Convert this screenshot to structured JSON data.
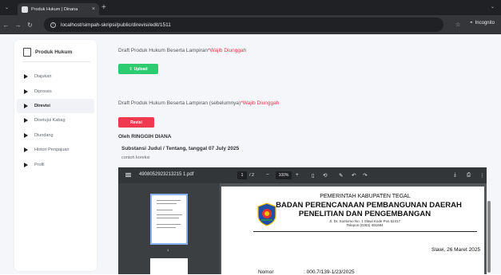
{
  "browser": {
    "tab_title": "Produk Hukum | Dinana",
    "tab_close": "×",
    "new_tab": "+",
    "url": "localhost/simpah-skripsi/public/direvisi/edit/1511",
    "incognito_label": "Incognito",
    "back": "←",
    "forward": "→",
    "reload": "↻"
  },
  "sidebar": {
    "brand": "Produk Hukum",
    "items": [
      {
        "label": "Diajukan",
        "active": false
      },
      {
        "label": "Diproses",
        "active": false
      },
      {
        "label": "Direvisi",
        "active": true
      },
      {
        "label": "Disetujui Kabag",
        "active": false
      },
      {
        "label": "Diundang",
        "active": false
      },
      {
        "label": "Histori Pengajuan",
        "active": false
      },
      {
        "label": "Profil",
        "active": false
      }
    ]
  },
  "main": {
    "draft_label": "Draft Produk Hukum Beserta Lampiran",
    "draft_required": "*Wajib Diunggah",
    "upload_label": "Upload",
    "prev_draft_label": "Draft Produk Hukum Beserta Lampiran (sebelumnya)",
    "prev_required": "*Wajib Diunggah",
    "revisi_label": "Revisi",
    "by_line": "Oleh RINGGIH DIANA",
    "substansi": "Substansi Judul / Tentang, tanggal 07 July 2025",
    "koreksi": "contoh koreksi"
  },
  "pdf": {
    "filename": "4908052923213215 1.pdf",
    "page_current": "1",
    "page_total": "/ 2",
    "zoom": "100%",
    "thumb_number": "1",
    "kop_1": "PEMERINTAH KABUPATEN TEGAL",
    "kop_2": "BADAN PERENCANAAN PEMBANGUNAN DAERAH",
    "kop_3": "PENELITIAN DAN PENGEMBANGAN",
    "kop_4": "Jl. Dr. Soetomo No. 1 Slawi Kode Pos 52417",
    "kop_5": "Telepon (0283) 491694",
    "tanggal": "Slawi, 26 Maret 2025",
    "nomor_label": "Nomor",
    "nomor_value": ": 000.7/139-1/23/2025",
    "tb_zoom_out": "−",
    "tb_zoom_in": "+"
  }
}
